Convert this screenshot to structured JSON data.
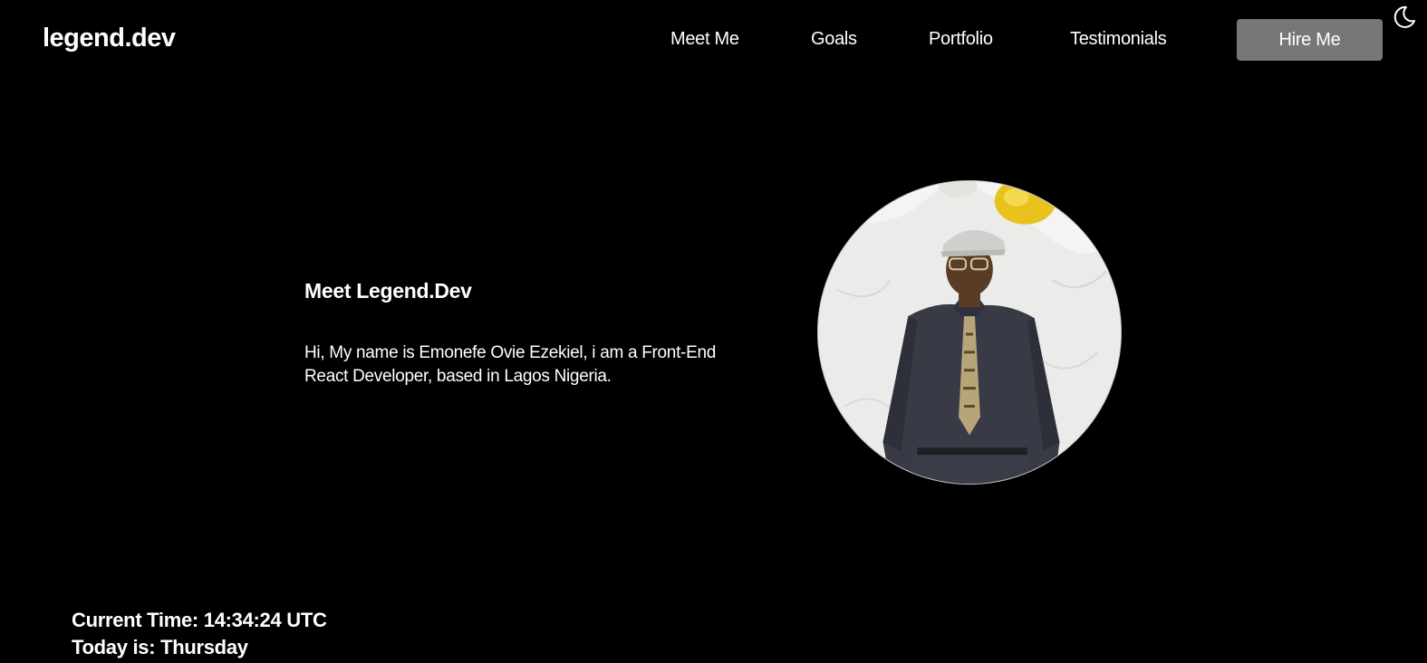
{
  "header": {
    "logo": "legend.dev",
    "nav": {
      "meet_me": "Meet Me",
      "goals": "Goals",
      "portfolio": "Portfolio",
      "testimonials": "Testimonials"
    },
    "hire_button": "Hire Me",
    "theme_toggle_icon": "moon-icon"
  },
  "hero": {
    "title": "Meet Legend.Dev",
    "description": "Hi, My name is Emonefe Ovie Ezekiel, i am a Front-End React Developer, based in Lagos Nigeria."
  },
  "info": {
    "time_prefix": "Current Time: ",
    "time_value": "14:34:24 UTC",
    "day_prefix": "Today is: ",
    "day_value": "Thursday"
  },
  "colors": {
    "background": "#000000",
    "text": "#ffffff",
    "button": "#777777"
  }
}
